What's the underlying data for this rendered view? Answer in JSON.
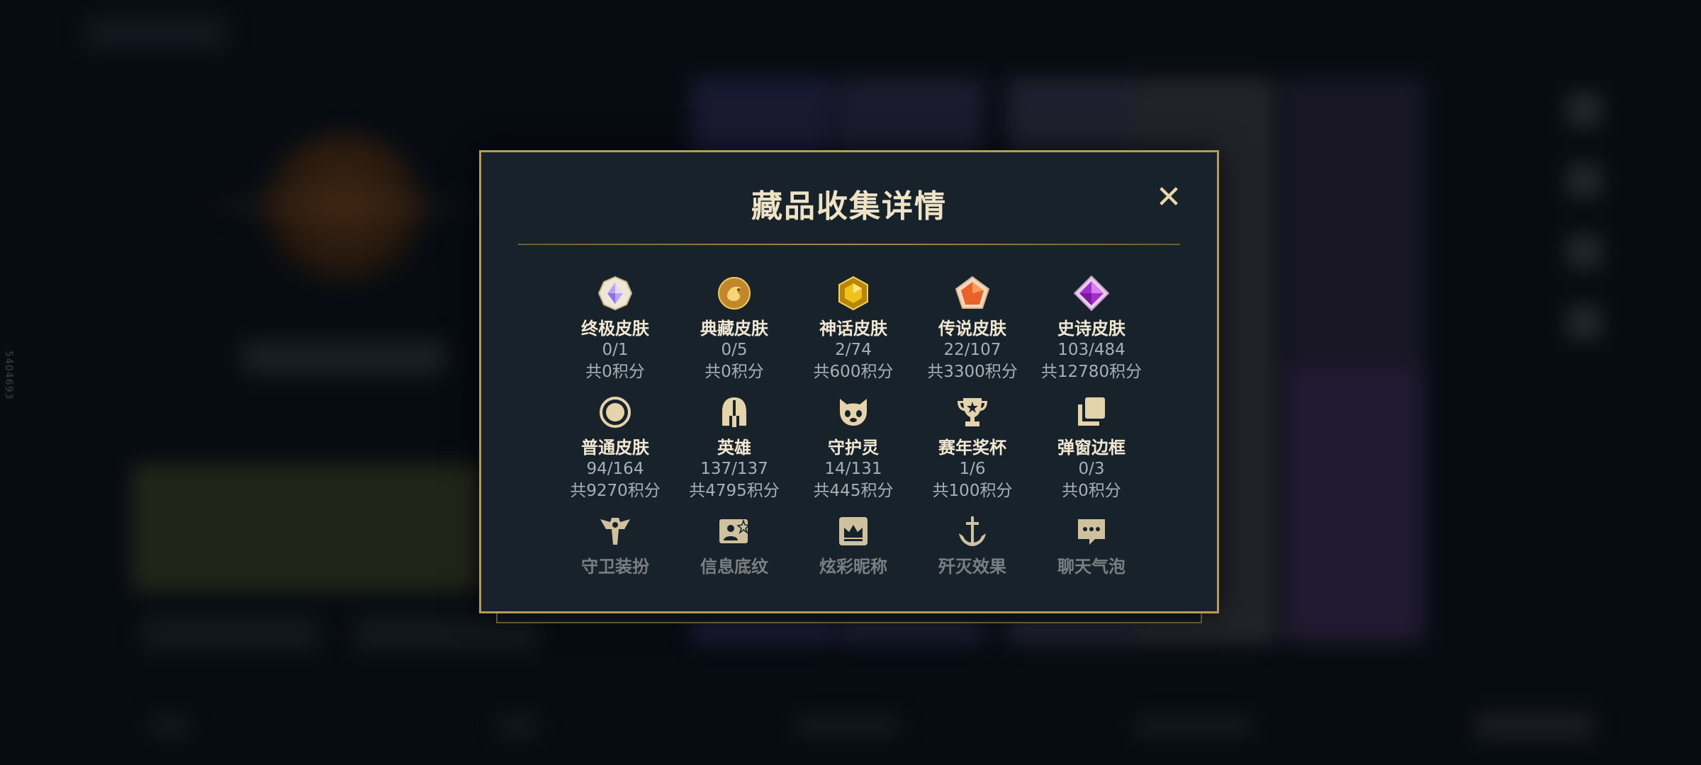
{
  "background": {
    "side_id": "5404693"
  },
  "modal": {
    "title": "藏品收集详情",
    "close_label": "✕",
    "categories": [
      {
        "name": "终极皮肤",
        "count": "0/1",
        "points": "共0积分",
        "icon": "ultimate-gem-icon",
        "color": "#c8b8ff"
      },
      {
        "name": "典藏皮肤",
        "count": "0/5",
        "points": "共0积分",
        "icon": "dragon-coin-icon",
        "color": "#d9a33a"
      },
      {
        "name": "神话皮肤",
        "count": "2/74",
        "points": "共600积分",
        "icon": "mythic-hexagon-icon",
        "color": "#e6b81e"
      },
      {
        "name": "传说皮肤",
        "count": "22/107",
        "points": "共3300积分",
        "icon": "legendary-pentagon-icon",
        "color": "#e8622a"
      },
      {
        "name": "史诗皮肤",
        "count": "103/484",
        "points": "共12780积分",
        "icon": "epic-diamond-icon",
        "color": "#b43ad8"
      },
      {
        "name": "普通皮肤",
        "count": "94/164",
        "points": "共9270积分",
        "icon": "ring-icon",
        "color": "#e4d3ab"
      },
      {
        "name": "英雄",
        "count": "137/137",
        "points": "共4795积分",
        "icon": "helmet-icon",
        "color": "#e4d3ab"
      },
      {
        "name": "守护灵",
        "count": "14/131",
        "points": "共445积分",
        "icon": "guardian-face-icon",
        "color": "#e4d3ab"
      },
      {
        "name": "赛年奖杯",
        "count": "1/6",
        "points": "共100积分",
        "icon": "trophy-icon",
        "color": "#e4d3ab"
      },
      {
        "name": "弹窗边框",
        "count": "0/3",
        "points": "共0积分",
        "icon": "stacked-frames-icon",
        "color": "#e4d3ab"
      },
      {
        "name": "守卫装扮",
        "icon": "ward-icon",
        "color": "#e4d3ab"
      },
      {
        "name": "信息底纹",
        "icon": "profile-card-icon",
        "color": "#e4d3ab"
      },
      {
        "name": "炫彩昵称",
        "icon": "crown-badge-icon",
        "color": "#e4d3ab"
      },
      {
        "name": "歼灭效果",
        "icon": "anchor-icon",
        "color": "#e4d3ab"
      },
      {
        "name": "聊天气泡",
        "icon": "chat-bubble-icon",
        "color": "#e4d3ab"
      }
    ]
  }
}
